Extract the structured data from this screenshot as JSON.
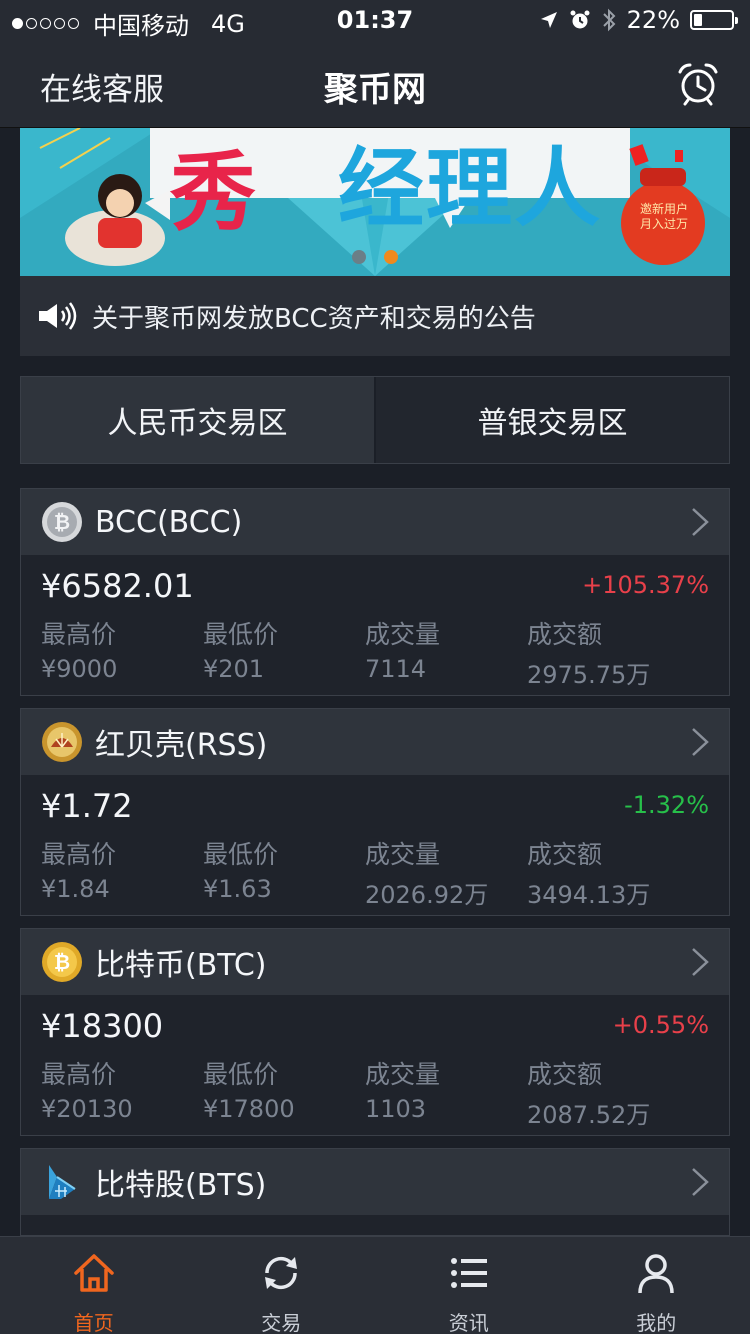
{
  "status_bar": {
    "carrier": "中国移动",
    "network": "4G",
    "time": "01:37",
    "battery": "22%",
    "battery_level": 0.22,
    "signal_dots_filled": 1,
    "signal_dots_total": 5
  },
  "navbar": {
    "left_label": "在线客服",
    "title": "聚币网",
    "right_icon": "alarm-clock-icon"
  },
  "banner": {
    "main_text": "经理人",
    "tag_line1": "邀新用户",
    "tag_line2": "月入过万",
    "pager_total": 2,
    "pager_active": 2
  },
  "notice": {
    "icon": "speaker-icon",
    "text": "关于聚币网发放BCC资产和交易的公告"
  },
  "zones": {
    "active": "人民币交易区",
    "inactive": "普银交易区"
  },
  "labels": {
    "high": "最高价",
    "low": "最低价",
    "volume": "成交量",
    "amount": "成交额"
  },
  "coins": [
    {
      "name": "BCC(BCC)",
      "icon": "bcc-coin-icon",
      "price": "¥6582.01",
      "change": "+105.37%",
      "direction": "up",
      "high": "¥9000",
      "low": "¥201",
      "volume": "7114",
      "amount": "2975.75万"
    },
    {
      "name": "红贝壳(RSS)",
      "icon": "rss-coin-icon",
      "price": "¥1.72",
      "change": "-1.32%",
      "direction": "down",
      "high": "¥1.84",
      "low": "¥1.63",
      "volume": "2026.92万",
      "amount": "3494.13万"
    },
    {
      "name": "比特币(BTC)",
      "icon": "btc-coin-icon",
      "price": "¥18300",
      "change": "+0.55%",
      "direction": "up",
      "high": "¥20130",
      "low": "¥17800",
      "volume": "1103",
      "amount": "2087.52万"
    },
    {
      "name": "比特股(BTS)",
      "icon": "bts-coin-icon"
    }
  ],
  "tabbar": [
    {
      "label": "首页",
      "icon": "home-icon",
      "active": true
    },
    {
      "label": "交易",
      "icon": "refresh-icon",
      "active": false
    },
    {
      "label": "资讯",
      "icon": "list-icon",
      "active": false
    },
    {
      "label": "我的",
      "icon": "user-icon",
      "active": false
    }
  ],
  "colors": {
    "up": "#e8404a",
    "down": "#27c04a",
    "accent": "#f0661f",
    "background": "#1b1f27"
  }
}
